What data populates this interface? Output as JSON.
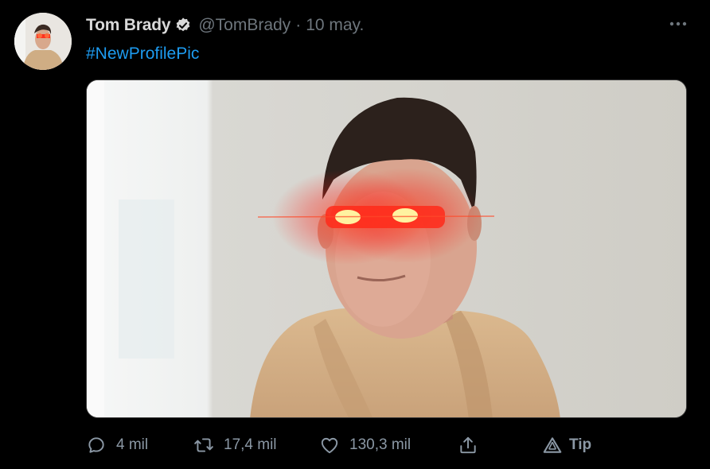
{
  "tweet": {
    "author_name": "Tom Brady",
    "author_handle": "@TomBrady",
    "separator": "·",
    "timestamp": "10 may.",
    "hashtag": "#NewProfilePic"
  },
  "icons": {
    "verified": "verified-badge-icon",
    "more": "more-options-icon",
    "reply": "reply-icon",
    "retweet": "retweet-icon",
    "like": "like-heart-icon",
    "share": "share-icon",
    "tip": "tip-icon"
  },
  "actions": {
    "reply_count": "4 mil",
    "retweet_count": "17,4 mil",
    "like_count": "130,3 mil",
    "tip_label": "Tip"
  },
  "colors": {
    "background": "#000000",
    "text": "#d9d9d9",
    "muted": "#6e767d",
    "link": "#1d9bf0",
    "action": "#8b98a5"
  }
}
